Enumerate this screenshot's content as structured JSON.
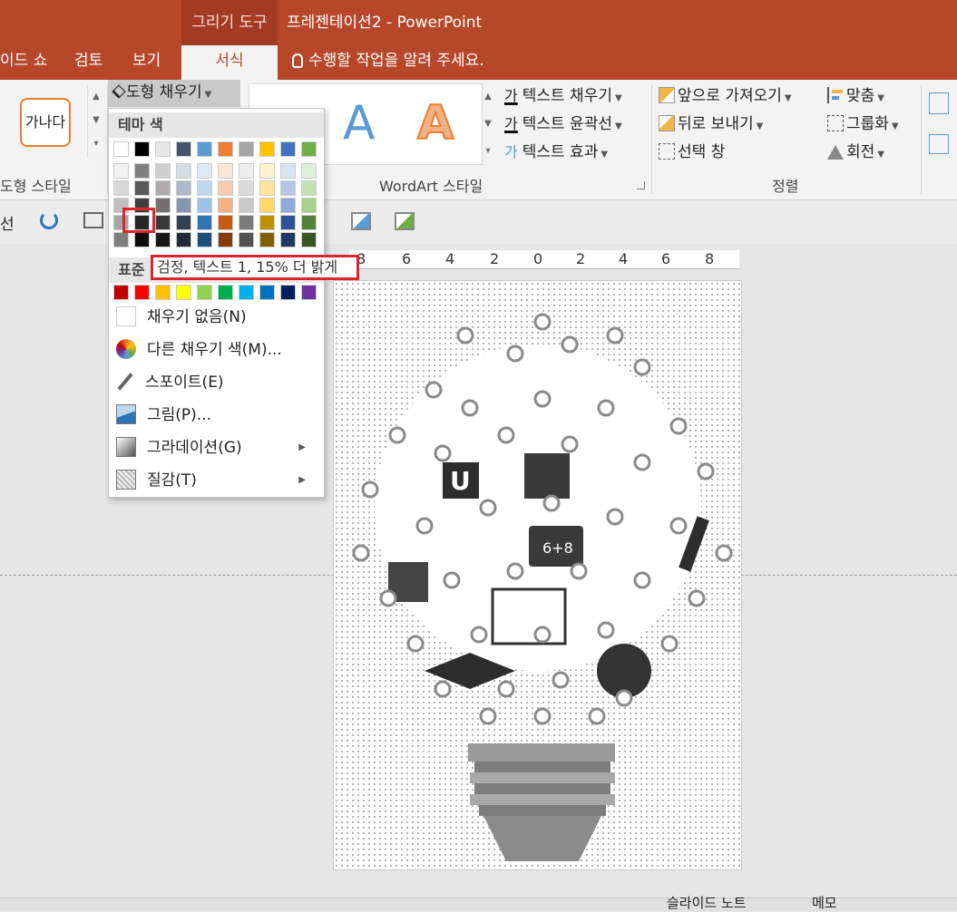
{
  "window": {
    "context_tab": "그리기 도구",
    "title": "프레젠테이션2 - PowerPoint"
  },
  "tabs": {
    "slideshow": "이드 쇼",
    "review": "검토",
    "view": "보기",
    "format": "서식",
    "tell_me": "수행할 작업을 알려 주세요."
  },
  "ribbon": {
    "shape_style_sample": "가나다",
    "shape_fill": "도형 채우기",
    "wordart_sample": "A",
    "text_fill": "텍스트 채우기",
    "text_outline": "텍스트 윤곽선",
    "text_effects": "텍스트 효과",
    "bring_forward": "앞으로 가져오기",
    "send_backward": "뒤로 보내기",
    "selection_pane": "선택 창",
    "align": "맞춤",
    "group": "그룹화",
    "rotate": "회전",
    "group_shape_styles": "도형 스타일",
    "group_wordart": "WordArt 스타일",
    "group_arrange": "정렬",
    "qat_partial": "선"
  },
  "dropdown": {
    "theme_colors": "테마 색",
    "standard_colors": "표준",
    "no_fill": "채우기 없음(N)",
    "more_colors": "다른 채우기 색(M)...",
    "eyedropper": "스포이트(E)",
    "picture": "그림(P)...",
    "gradient": "그라데이션(G)",
    "texture": "질감(T)",
    "tooltip": "검정, 텍스트 1, 15% 더 밝게",
    "theme_top": [
      "#ffffff",
      "#000000",
      "#e7e6e6",
      "#44546a",
      "#5b9bd5",
      "#ed7d31",
      "#a5a5a5",
      "#ffc000",
      "#4472c4",
      "#70ad47"
    ],
    "theme_shades": [
      [
        "#f2f2f2",
        "#7f7f7f",
        "#d0cece",
        "#d6dce4",
        "#deebf6",
        "#fbe5d5",
        "#ededed",
        "#fff2cc",
        "#d9e2f3",
        "#e2efd9"
      ],
      [
        "#d8d8d8",
        "#595959",
        "#aeaaaa",
        "#adb9ca",
        "#bdd7ee",
        "#f7cbac",
        "#dbdbdb",
        "#fee599",
        "#b4c6e7",
        "#c5e0b3"
      ],
      [
        "#bfbfbf",
        "#3f3f3f",
        "#757070",
        "#8496b0",
        "#9cc3e5",
        "#f4b183",
        "#c9c9c9",
        "#ffd965",
        "#8eaadb",
        "#a8d08d"
      ],
      [
        "#a5a5a5",
        "#262626",
        "#3a3838",
        "#323f4f",
        "#2e75b5",
        "#c55a11",
        "#7b7b7b",
        "#bf9000",
        "#2f5496",
        "#538135"
      ],
      [
        "#7f7f7f",
        "#0c0c0c",
        "#171616",
        "#222a35",
        "#1e4e79",
        "#833c0b",
        "#525252",
        "#7f6000",
        "#1f3864",
        "#375623"
      ]
    ],
    "standard": [
      "#c00000",
      "#ff0000",
      "#ffc000",
      "#ffff00",
      "#92d050",
      "#00b050",
      "#00b0f0",
      "#0070c0",
      "#002060",
      "#7030a0"
    ]
  },
  "ruler": [
    "8",
    "6",
    "4",
    "2",
    "0",
    "2",
    "4",
    "6",
    "8"
  ],
  "status": {
    "notes": "슬라이드 노트",
    "memo": "메모"
  }
}
